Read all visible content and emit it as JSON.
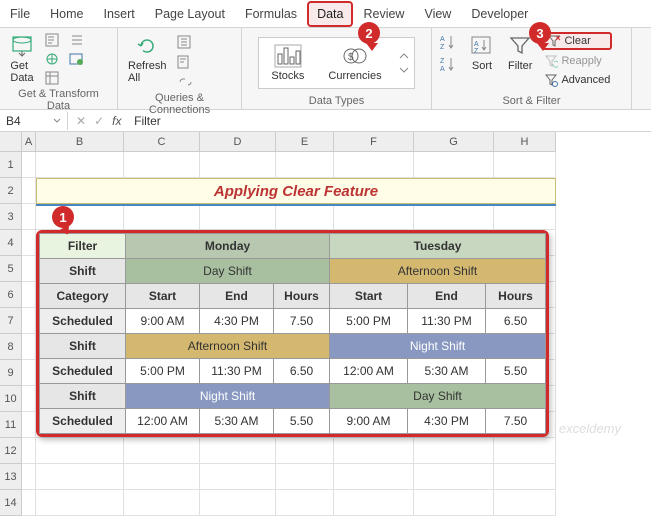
{
  "tabs": [
    "File",
    "Home",
    "Insert",
    "Page Layout",
    "Formulas",
    "Data",
    "Review",
    "View",
    "Developer"
  ],
  "active_tab": "Data",
  "badges": {
    "b1": "1",
    "b2": "2",
    "b3": "3"
  },
  "ribbon": {
    "get_data": "Get\nData",
    "refresh": "Refresh\nAll",
    "stocks": "Stocks",
    "currencies": "Currencies",
    "sort": "Sort",
    "filter": "Filter",
    "clear": "Clear",
    "reapply": "Reapply",
    "advanced": "Advanced",
    "group_transform": "Get & Transform Data",
    "group_queries": "Queries & Connections",
    "group_types": "Data Types",
    "group_sortfilter": "Sort & Filter"
  },
  "namebox": "B4",
  "formula": "Filter",
  "cols": [
    "A",
    "B",
    "C",
    "D",
    "E",
    "F",
    "G",
    "H"
  ],
  "rows": [
    "1",
    "2",
    "3",
    "4",
    "5",
    "6",
    "7",
    "8",
    "9",
    "10",
    "11",
    "12",
    "13",
    "14"
  ],
  "title": "Applying Clear Feature",
  "table": {
    "header": {
      "filter": "Filter",
      "mon": "Monday",
      "tue": "Tuesday"
    },
    "labels": {
      "shift": "Shift",
      "category": "Category",
      "start": "Start",
      "end": "End",
      "hours": "Hours",
      "scheduled": "Scheduled"
    },
    "shifts": {
      "day": "Day Shift",
      "afternoon": "Afternoon Shift",
      "night": "Night Shift"
    },
    "r1": {
      "m_start": "9:00 AM",
      "m_end": "4:30 PM",
      "m_hrs": "7.50",
      "t_start": "5:00 PM",
      "t_end": "11:30 PM",
      "t_hrs": "6.50"
    },
    "r2": {
      "m_start": "5:00 PM",
      "m_end": "11:30 PM",
      "m_hrs": "6.50",
      "t_start": "12:00 AM",
      "t_end": "5:30 AM",
      "t_hrs": "5.50"
    },
    "r3": {
      "m_start": "12:00 AM",
      "m_end": "5:30 AM",
      "m_hrs": "5.50",
      "t_start": "9:00 AM",
      "t_end": "4:30 PM",
      "t_hrs": "7.50"
    }
  },
  "watermark": "exceldemy"
}
